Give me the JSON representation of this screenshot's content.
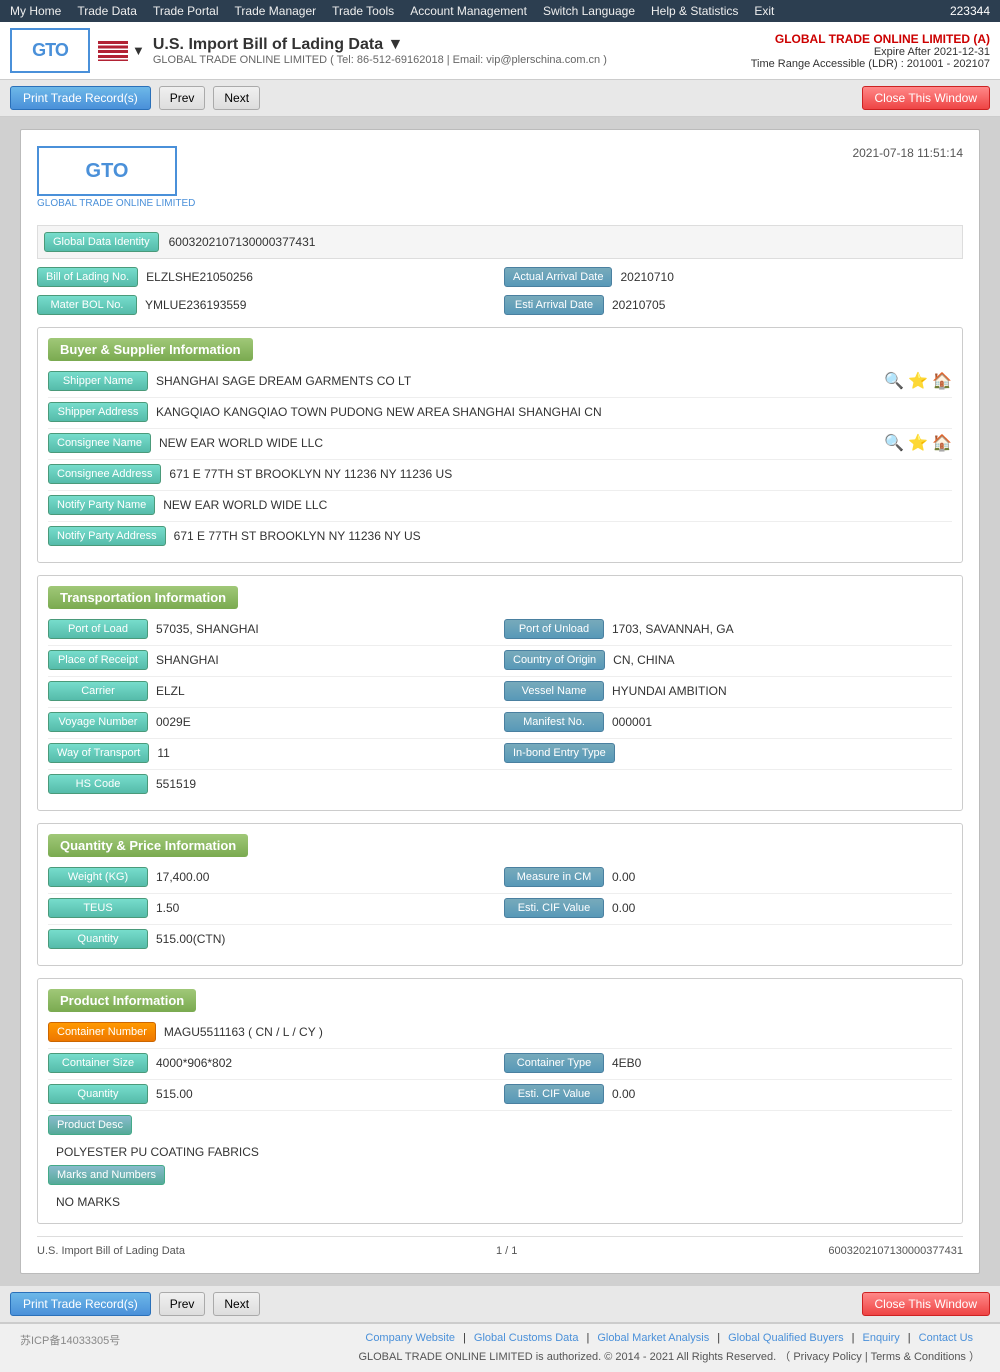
{
  "nav": {
    "items": [
      "My Home",
      "Trade Data",
      "Trade Portal",
      "Trade Manager",
      "Trade Tools",
      "Account Management",
      "Switch Language",
      "Help & Statistics",
      "Exit"
    ],
    "user_id": "223344"
  },
  "header": {
    "logo_text": "GTO",
    "flag_label": "▼",
    "title": "U.S. Import Bill of Lading Data ▼",
    "subtitle": "GLOBAL TRADE ONLINE LIMITED ( Tel: 86-512-69162018 | Email: vip@plerschina.com.cn )",
    "company_name": "GLOBAL TRADE ONLINE LIMITED (A)",
    "expire": "Expire After 2021-12-31",
    "time_range": "Time Range Accessible (LDR) : 201001 - 202107"
  },
  "toolbar": {
    "print_label": "Print Trade Record(s)",
    "prev_label": "Prev",
    "next_label": "Next",
    "close_label": "Close This Window"
  },
  "document": {
    "logo_text": "GTO",
    "logo_sub": "GLOBAL TRADE ONLINE LIMITED",
    "datetime": "2021-07-18 11:51:14",
    "global_data_identity_label": "Global Data Identity",
    "global_data_identity_value": "6003202107130000377431",
    "bol_no_label": "Bill of Lading No.",
    "bol_no_value": "ELZLSHE21050256",
    "actual_arrival_label": "Actual Arrival Date",
    "actual_arrival_value": "20210710",
    "mater_bol_label": "Mater BOL No.",
    "mater_bol_value": "YMLUE236193559",
    "esti_arrival_label": "Esti Arrival Date",
    "esti_arrival_value": "20210705",
    "buyer_supplier": {
      "title": "Buyer & Supplier Information",
      "shipper_name_label": "Shipper Name",
      "shipper_name_value": "SHANGHAI SAGE DREAM GARMENTS CO LT",
      "shipper_address_label": "Shipper Address",
      "shipper_address_value": "KANGQIAO KANGQIAO TOWN PUDONG NEW AREA SHANGHAI SHANGHAI CN",
      "consignee_name_label": "Consignee Name",
      "consignee_name_value": "NEW EAR WORLD WIDE LLC",
      "consignee_address_label": "Consignee Address",
      "consignee_address_value": "671 E 77TH ST BROOKLYN NY 11236 NY 11236 US",
      "notify_party_name_label": "Notify Party Name",
      "notify_party_name_value": "NEW EAR WORLD WIDE LLC",
      "notify_party_address_label": "Notify Party Address",
      "notify_party_address_value": "671 E 77TH ST BROOKLYN NY 11236 NY US"
    },
    "transportation": {
      "title": "Transportation Information",
      "port_load_label": "Port of Load",
      "port_load_value": "57035, SHANGHAI",
      "port_unload_label": "Port of Unload",
      "port_unload_value": "1703, SAVANNAH, GA",
      "place_receipt_label": "Place of Receipt",
      "place_receipt_value": "SHANGHAI",
      "country_origin_label": "Country of Origin",
      "country_origin_value": "CN, CHINA",
      "carrier_label": "Carrier",
      "carrier_value": "ELZL",
      "vessel_name_label": "Vessel Name",
      "vessel_name_value": "HYUNDAI AMBITION",
      "voyage_number_label": "Voyage Number",
      "voyage_number_value": "0029E",
      "manifest_no_label": "Manifest No.",
      "manifest_no_value": "000001",
      "way_of_transport_label": "Way of Transport",
      "way_of_transport_value": "11",
      "inbond_entry_label": "In-bond Entry Type",
      "inbond_entry_value": "",
      "hs_code_label": "HS Code",
      "hs_code_value": "551519"
    },
    "quantity": {
      "title": "Quantity & Price Information",
      "weight_label": "Weight (KG)",
      "weight_value": "17,400.00",
      "measure_label": "Measure in CM",
      "measure_value": "0.00",
      "teus_label": "TEUS",
      "teus_value": "1.50",
      "esti_cif_label": "Esti. CIF Value",
      "esti_cif_value": "0.00",
      "quantity_label": "Quantity",
      "quantity_value": "515.00(CTN)"
    },
    "product": {
      "title": "Product Information",
      "container_number_label": "Container Number",
      "container_number_value": "MAGU5511163 ( CN / L / CY )",
      "container_size_label": "Container Size",
      "container_size_value": "4000*906*802",
      "container_type_label": "Container Type",
      "container_type_value": "4EB0",
      "quantity_label": "Quantity",
      "quantity_value": "515.00",
      "esti_cif_label": "Esti. CIF Value",
      "esti_cif_value": "0.00",
      "product_desc_label": "Product Desc",
      "product_desc_value": "POLYESTER PU COATING FABRICS",
      "marks_label": "Marks and Numbers",
      "marks_value": "NO MARKS"
    },
    "footer": {
      "left": "U.S. Import Bill of Lading Data",
      "page": "1 / 1",
      "record_id": "6003202107130000377431"
    }
  },
  "bottom_footer": {
    "icp": "苏ICP备14033305号",
    "links": [
      "Company Website",
      "Global Customs Data",
      "Global Market Analysis",
      "Global Qualified Buyers",
      "Enquiry",
      "Contact Us"
    ],
    "copyright": "GLOBAL TRADE ONLINE LIMITED is authorized. © 2014 - 2021 All Rights Reserved.",
    "privacy": "Privacy Policy",
    "terms": "Terms & Conditions"
  }
}
